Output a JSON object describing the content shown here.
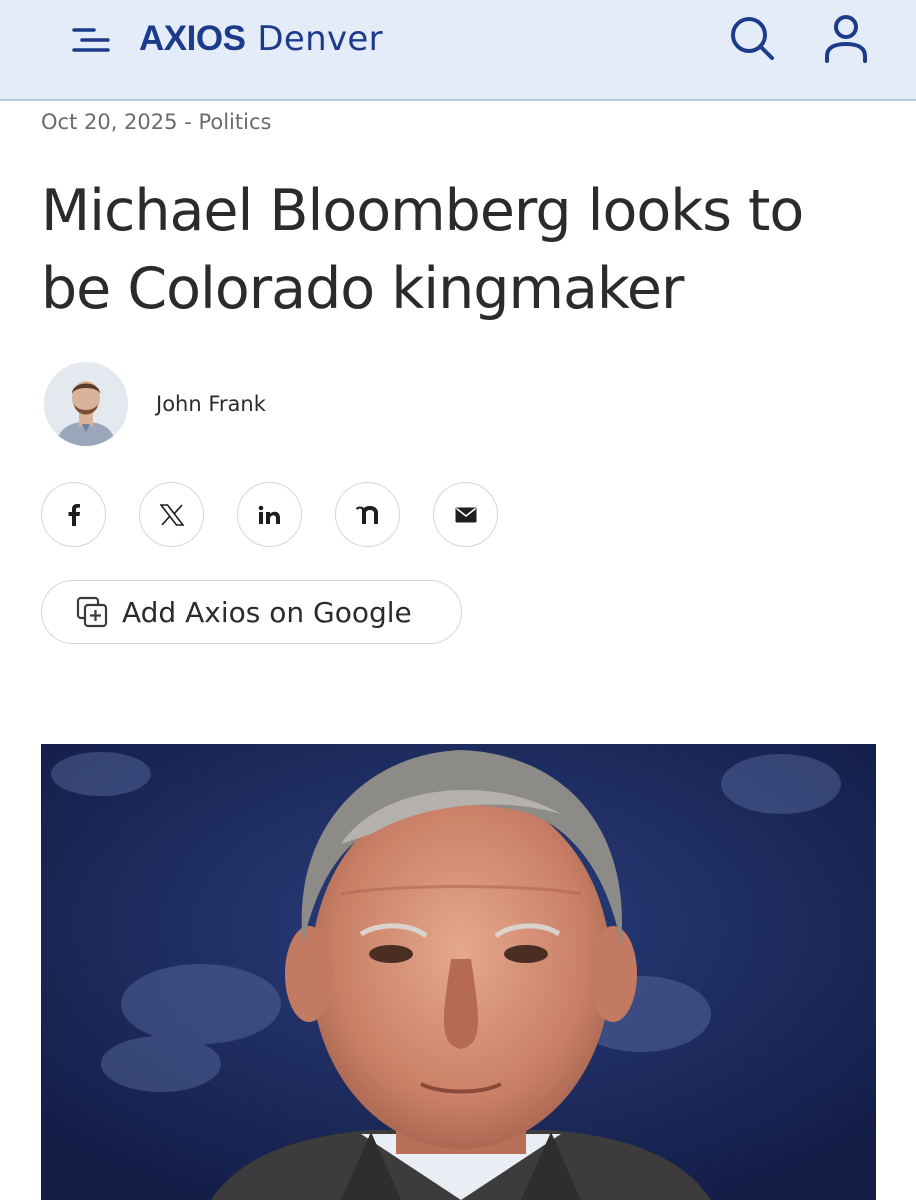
{
  "header": {
    "brand": "AXIOS",
    "city": "Denver",
    "background": "#e3ecf8",
    "brand_color": "#1d3b8a",
    "icons": [
      "menu-icon",
      "search-icon",
      "account-icon"
    ]
  },
  "article": {
    "date": "Oct 20, 2025",
    "separator": "-",
    "category": "Politics",
    "headline": "Michael Bloomberg looks to be Colorado kingmaker",
    "author": "John Frank"
  },
  "share": {
    "buttons": [
      "facebook-icon",
      "x-icon",
      "linkedin-icon",
      "threads-icon",
      "email-icon"
    ]
  },
  "google_button": {
    "label": "Add Axios on Google",
    "icon": "add-to-collection-icon"
  },
  "hero": {
    "background": "#1d2c5e"
  }
}
